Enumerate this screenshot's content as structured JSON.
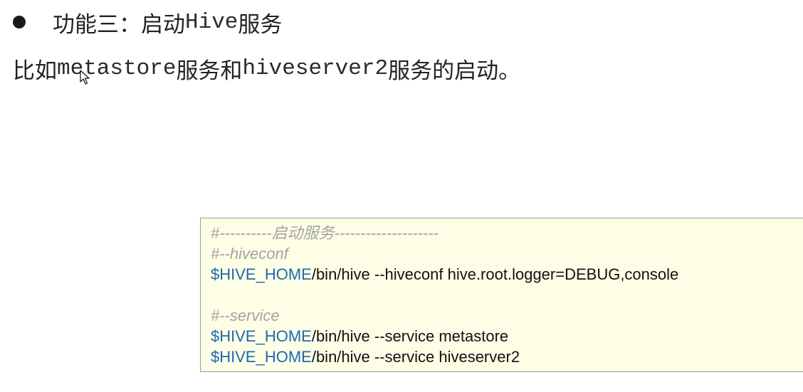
{
  "heading": {
    "prefix": "功能三：启动",
    "mono": "Hive",
    "suffix": "服务"
  },
  "paragraph": {
    "part1": "比如",
    "part2": "metastore",
    "part3": "服务和",
    "part4": "hiveserver2",
    "part5": "服务的启动。"
  },
  "code": {
    "lines": [
      {
        "comment": "#----------启动服务--------------------"
      },
      {
        "comment": "#--hiveconf"
      },
      {
        "var": "$HIVE_HOME",
        "rest": "/bin/hive --hiveconf hive.root.logger=DEBUG,console"
      },
      {
        "comment": ""
      },
      {
        "comment": "#--service"
      },
      {
        "var": "$HIVE_HOME",
        "rest": "/bin/hive --service metastore"
      },
      {
        "var": "$HIVE_HOME",
        "rest": "/bin/hive --service hiveserver2"
      }
    ]
  },
  "icons": {
    "bullet": "bullet-dot-icon",
    "cursor": "mouse-pointer-icon"
  }
}
